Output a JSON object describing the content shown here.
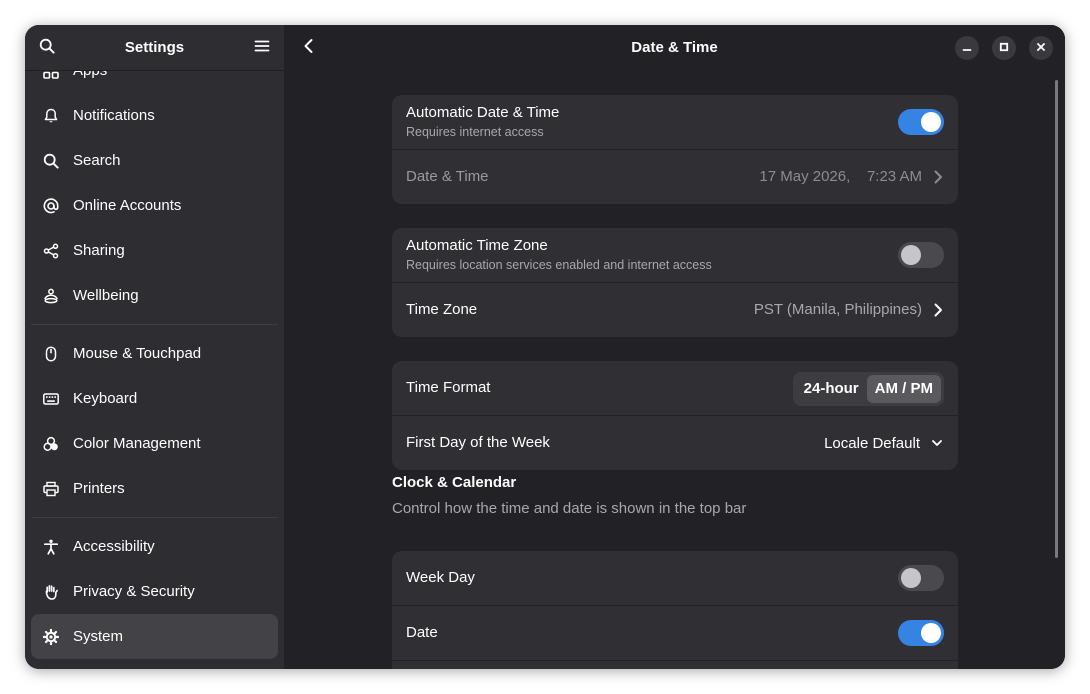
{
  "sidebar": {
    "title": "Settings",
    "search_icon": "search-icon",
    "menu_icon": "hamburger-menu-icon",
    "items": [
      {
        "label": "Apps",
        "icon": "apps-grid-icon"
      },
      {
        "label": "Notifications",
        "icon": "bell-icon"
      },
      {
        "label": "Search",
        "icon": "search-icon"
      },
      {
        "label": "Online Accounts",
        "icon": "at-sign-icon"
      },
      {
        "label": "Sharing",
        "icon": "share-icon"
      },
      {
        "label": "Wellbeing",
        "icon": "wellbeing-icon"
      },
      {
        "label": "Mouse & Touchpad",
        "icon": "mouse-icon"
      },
      {
        "label": "Keyboard",
        "icon": "keyboard-icon"
      },
      {
        "label": "Color Management",
        "icon": "color-circles-icon"
      },
      {
        "label": "Printers",
        "icon": "printer-icon"
      },
      {
        "label": "Accessibility",
        "icon": "accessibility-person-icon"
      },
      {
        "label": "Privacy & Security",
        "icon": "hand-icon"
      },
      {
        "label": "System",
        "icon": "gear-icon",
        "active": true
      }
    ]
  },
  "content": {
    "title": "Date & Time",
    "back_icon": "chevron-left-icon",
    "window_controls": [
      "minimize-icon",
      "maximize-icon",
      "close-icon"
    ],
    "automatic_group": {
      "auto_datetime": {
        "title": "Automatic Date & Time",
        "subtitle": "Requires internet access",
        "enabled": true
      },
      "datetime": {
        "title": "Date & Time",
        "date": "17 May 2026,",
        "time": "7:23 AM"
      }
    },
    "timezone_group": {
      "auto_timezone": {
        "title": "Automatic Time Zone",
        "subtitle": "Requires location services enabled and internet access",
        "enabled": false
      },
      "timezone": {
        "title": "Time Zone",
        "value": "PST (Manila, Philippines)"
      }
    },
    "format_group": {
      "time_format": {
        "title": "Time Format",
        "options": [
          "24-hour",
          "AM / PM"
        ],
        "selected": "AM / PM"
      },
      "first_day": {
        "title": "First Day of the Week",
        "value": "Locale Default"
      }
    },
    "clock_calendar": {
      "title": "Clock & Calendar",
      "subtitle": "Control how the time and date is shown in the top bar",
      "week_day": {
        "title": "Week Day",
        "enabled": false
      },
      "date": {
        "title": "Date",
        "enabled": true
      }
    }
  },
  "colors": {
    "accent": "#3584e4",
    "window_bg": "#222226",
    "sidebar_bg": "#2e2e32",
    "card_bg": "#303034"
  }
}
